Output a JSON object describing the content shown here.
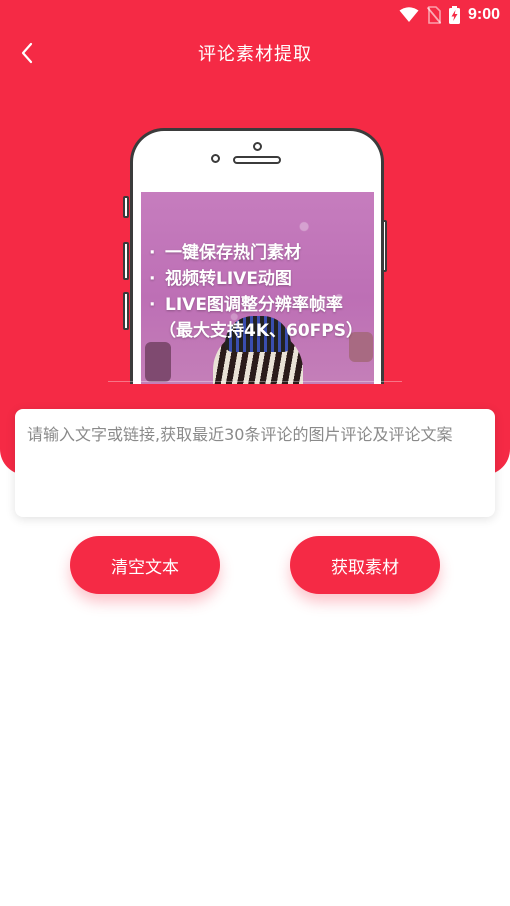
{
  "status_bar": {
    "time": "9:00",
    "icons": [
      "wifi-icon",
      "no-sim-icon",
      "battery-charging-icon"
    ]
  },
  "header": {
    "title": "评论素材提取",
    "back_icon": "chevron-left-icon"
  },
  "illustration": {
    "features": [
      "一键保存热门素材",
      "视频转LIVE动图",
      "LIVE图调整分辨率帧率"
    ],
    "feature_sub": "（最大支持4K、60FPS）"
  },
  "input": {
    "value": "",
    "placeholder": "请输入文字或链接,获取最近30条评论的图片评论及评论文案"
  },
  "buttons": {
    "clear_label": "清空文本",
    "fetch_label": "获取素材"
  },
  "colors": {
    "accent": "#f52a45",
    "background": "#ffffff"
  }
}
